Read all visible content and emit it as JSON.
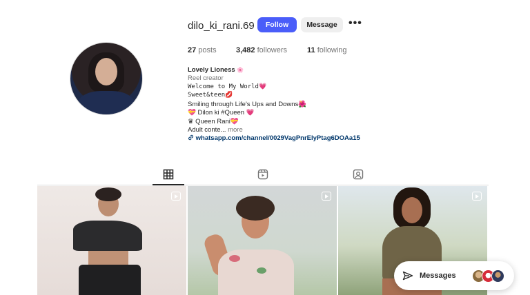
{
  "profile": {
    "username": "dilo_ki_rani.69",
    "follow_label": "Follow",
    "message_label": "Message",
    "more_label": "•••"
  },
  "stats": {
    "posts_count": "27",
    "posts_label": " posts",
    "followers_count": "3,482",
    "followers_label": " followers",
    "following_count": "11",
    "following_label": " following"
  },
  "bio": {
    "name": "Lovely Lioness",
    "name_emoji": "🌸",
    "category": "Reel creator",
    "line1": "Welcome to My World",
    "line1_emoji": "💗",
    "line2": "Sweet&teen",
    "line2_emoji": "💋",
    "line3": "Smiling through Life's Ups and Downs",
    "line3_emoji": "🌺",
    "line4_emoji_pre": "💝",
    "line4": " Dilon ki #Queen ",
    "line4_emoji_post": "💗",
    "line5_emoji_pre": "♛",
    "line5": " Queen Rani",
    "line5_emoji_post": "💝",
    "line6": "Adult conte...",
    "more_label": " more",
    "link": "whatsapp.com/channel/0029VagPnrElyPtag6DOAa15"
  },
  "tabs": [
    {
      "name": "posts",
      "icon": "grid-icon",
      "active": true
    },
    {
      "name": "reels",
      "icon": "reels-icon",
      "active": false
    },
    {
      "name": "tagged",
      "icon": "tagged-icon",
      "active": false
    }
  ],
  "messages": {
    "label": "Messages"
  },
  "colors": {
    "accent": "#4a5df9",
    "link": "#00376b",
    "muted": "#737373"
  }
}
